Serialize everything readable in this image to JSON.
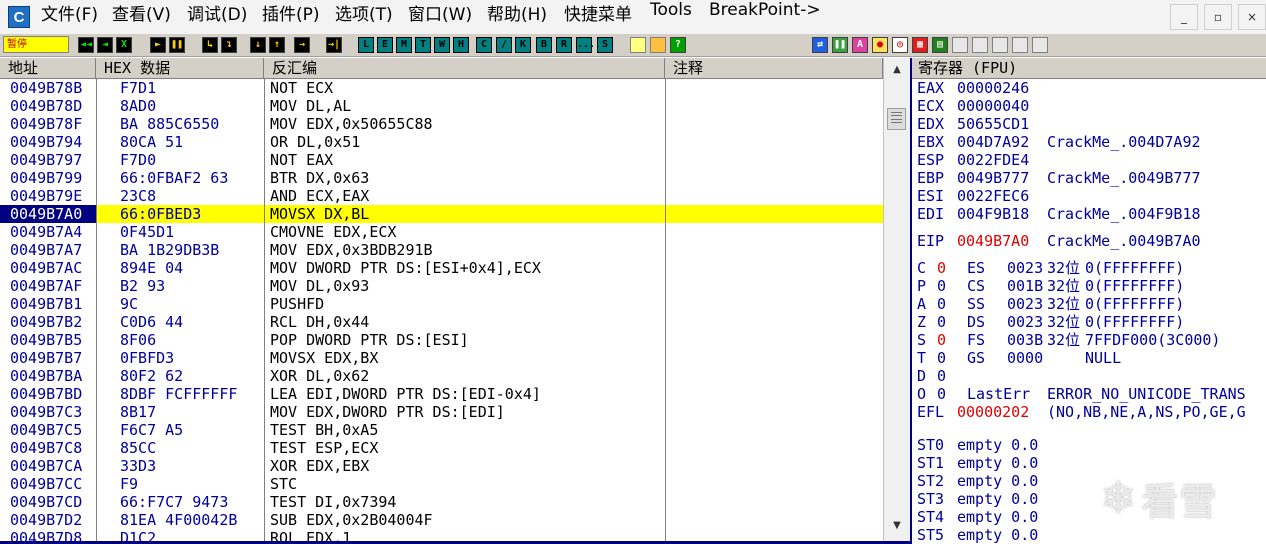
{
  "menu": {
    "app_icon": "C",
    "items": [
      "文件(F)",
      "查看(V)",
      "调试(D)",
      "插件(P)",
      "选项(T)",
      "窗口(W)",
      "帮助(H)",
      "快捷菜单",
      "Tools",
      "BreakPoint->"
    ],
    "window_buttons": [
      "_",
      "▫",
      "×"
    ]
  },
  "toolbar": {
    "status": "暂停",
    "debug_buttons": [
      "◄◄",
      "◄",
      "X",
      "►",
      "❚❚",
      "↳",
      "↴",
      "↓",
      "↑",
      "→",
      "→|"
    ],
    "letter_buttons": [
      "L",
      "E",
      "M",
      "T",
      "W",
      "H",
      "C",
      "/",
      "K",
      "B",
      "R",
      "...",
      "S"
    ],
    "icons": [
      "list-icon",
      "grid-icon",
      "help-icon",
      "refresh-icon",
      "a-icon",
      "record-icon",
      "target-icon",
      "window-icon"
    ]
  },
  "columns": {
    "address": "地址",
    "hex": "HEX 数据",
    "disasm": "反汇编",
    "comment": "注释"
  },
  "registers_title": "寄存器 (FPU)",
  "disassembly": [
    {
      "addr": "0049B78B",
      "hex": "F7D1",
      "asm": "NOT ECX"
    },
    {
      "addr": "0049B78D",
      "hex": "8AD0",
      "asm": "MOV DL,AL"
    },
    {
      "addr": "0049B78F",
      "hex": "BA 885C6550",
      "asm": "MOV EDX,0x50655C88"
    },
    {
      "addr": "0049B794",
      "hex": "80CA 51",
      "asm": "OR DL,0x51"
    },
    {
      "addr": "0049B797",
      "hex": "F7D0",
      "asm": "NOT EAX"
    },
    {
      "addr": "0049B799",
      "hex": "66:0FBAF2 63",
      "asm": "BTR DX,0x63"
    },
    {
      "addr": "0049B79E",
      "hex": "23C8",
      "asm": "AND ECX,EAX"
    },
    {
      "addr": "0049B7A0",
      "hex": "66:0FBED3",
      "asm": "MOVSX DX,BL",
      "selected": true
    },
    {
      "addr": "0049B7A4",
      "hex": "0F45D1",
      "asm": "CMOVNE EDX,ECX"
    },
    {
      "addr": "0049B7A7",
      "hex": "BA 1B29DB3B",
      "asm": "MOV EDX,0x3BDB291B"
    },
    {
      "addr": "0049B7AC",
      "hex": "894E 04",
      "asm": "MOV DWORD PTR DS:[ESI+0x4],ECX"
    },
    {
      "addr": "0049B7AF",
      "hex": "B2 93",
      "asm": "MOV DL,0x93"
    },
    {
      "addr": "0049B7B1",
      "hex": "9C",
      "asm": "PUSHFD"
    },
    {
      "addr": "0049B7B2",
      "hex": "C0D6 44",
      "asm": "RCL DH,0x44"
    },
    {
      "addr": "0049B7B5",
      "hex": "8F06",
      "asm": "POP DWORD PTR DS:[ESI]"
    },
    {
      "addr": "0049B7B7",
      "hex": "0FBFD3",
      "asm": "MOVSX EDX,BX"
    },
    {
      "addr": "0049B7BA",
      "hex": "80F2 62",
      "asm": "XOR DL,0x62"
    },
    {
      "addr": "0049B7BD",
      "hex": "8DBF FCFFFFFF",
      "asm": "LEA EDI,DWORD PTR DS:[EDI-0x4]"
    },
    {
      "addr": "0049B7C3",
      "hex": "8B17",
      "asm": "MOV EDX,DWORD PTR DS:[EDI]"
    },
    {
      "addr": "0049B7C5",
      "hex": "F6C7 A5",
      "asm": "TEST BH,0xA5"
    },
    {
      "addr": "0049B7C8",
      "hex": "85CC",
      "asm": "TEST ESP,ECX"
    },
    {
      "addr": "0049B7CA",
      "hex": "33D3",
      "asm": "XOR EDX,EBX"
    },
    {
      "addr": "0049B7CC",
      "hex": "F9",
      "asm": "STC"
    },
    {
      "addr": "0049B7CD",
      "hex": "66:F7C7 9473",
      "asm": "TEST DI,0x7394"
    },
    {
      "addr": "0049B7D2",
      "hex": "81EA 4F00042B",
      "asm": "SUB EDX,0x2B04004F"
    },
    {
      "addr": "0049B7D8",
      "hex": "D1C2",
      "asm": "ROL EDX,1"
    }
  ],
  "registers": [
    {
      "name": "EAX",
      "value": "00000246",
      "note": ""
    },
    {
      "name": "ECX",
      "value": "00000040",
      "note": ""
    },
    {
      "name": "EDX",
      "value": "50655CD1",
      "note": ""
    },
    {
      "name": "EBX",
      "value": "004D7A92",
      "note": "CrackMe_.004D7A92"
    },
    {
      "name": "ESP",
      "value": "0022FDE4",
      "note": ""
    },
    {
      "name": "EBP",
      "value": "0049B777",
      "note": "CrackMe_.0049B777"
    },
    {
      "name": "ESI",
      "value": "0022FEC6",
      "note": ""
    },
    {
      "name": "EDI",
      "value": "004F9B18",
      "note": "CrackMe_.004F9B18"
    }
  ],
  "eip": {
    "name": "EIP",
    "value": "0049B7A0",
    "note": "CrackMe_.0049B7A0"
  },
  "flags": [
    {
      "flag": "C",
      "val": "0",
      "changed": true,
      "seg": "ES",
      "sel": "0023",
      "bits": "32位",
      "base": "0(FFFFFFFF)"
    },
    {
      "flag": "P",
      "val": "0",
      "changed": false,
      "seg": "CS",
      "sel": "001B",
      "bits": "32位",
      "base": "0(FFFFFFFF)"
    },
    {
      "flag": "A",
      "val": "0",
      "changed": false,
      "seg": "SS",
      "sel": "0023",
      "bits": "32位",
      "base": "0(FFFFFFFF)"
    },
    {
      "flag": "Z",
      "val": "0",
      "changed": false,
      "seg": "DS",
      "sel": "0023",
      "bits": "32位",
      "base": "0(FFFFFFFF)"
    },
    {
      "flag": "S",
      "val": "0",
      "changed": true,
      "seg": "FS",
      "sel": "003B",
      "bits": "32位",
      "base": "7FFDF000(3C000)"
    },
    {
      "flag": "T",
      "val": "0",
      "changed": false,
      "seg": "GS",
      "sel": "0000",
      "bits": "",
      "base": "NULL"
    },
    {
      "flag": "D",
      "val": "0",
      "changed": false,
      "seg": "",
      "sel": "",
      "bits": "",
      "base": ""
    },
    {
      "flag": "O",
      "val": "0",
      "changed": false,
      "seg": "LastErr",
      "sel": "",
      "bits": "",
      "base": "ERROR_NO_UNICODE_TRANS"
    }
  ],
  "efl": {
    "name": "EFL",
    "value": "00000202",
    "note": "(NO,NB,NE,A,NS,PO,GE,G"
  },
  "fpu": [
    {
      "name": "ST0",
      "value": "empty 0.0"
    },
    {
      "name": "ST1",
      "value": "empty 0.0"
    },
    {
      "name": "ST2",
      "value": "empty 0.0"
    },
    {
      "name": "ST3",
      "value": "empty 0.0"
    },
    {
      "name": "ST4",
      "value": "empty 0.0"
    },
    {
      "name": "ST5",
      "value": "empty 0.0"
    }
  ],
  "watermark": "看雪",
  "colors": {
    "selection": "#ffff00",
    "address_selected_bg": "#000080",
    "changed_value": "#e00000",
    "text_blue": "#00009c"
  }
}
